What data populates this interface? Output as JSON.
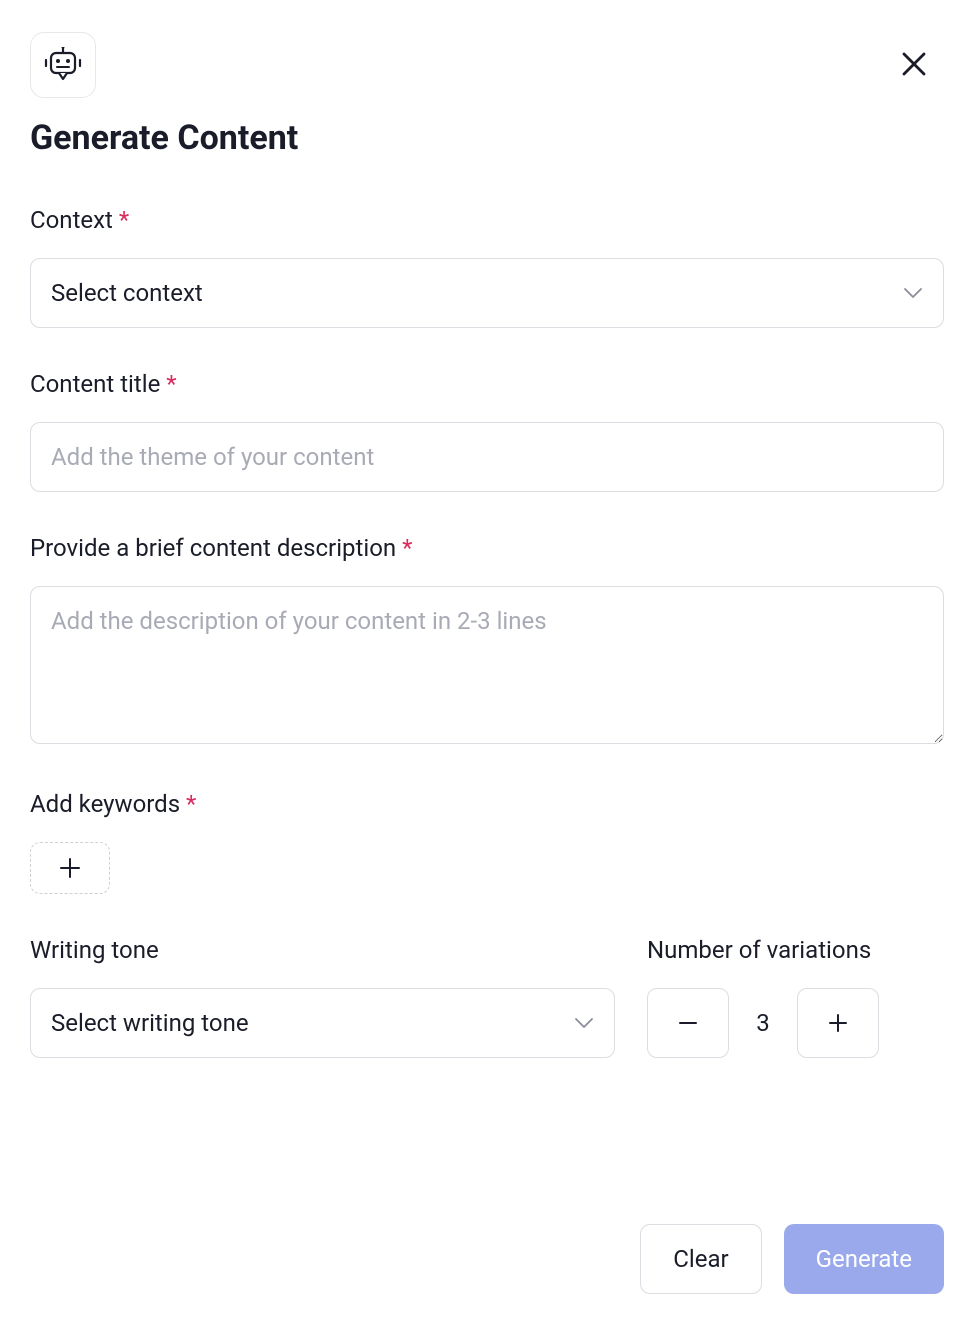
{
  "page_title": "Generate Content",
  "fields": {
    "context": {
      "label": "Context",
      "required": true,
      "placeholder": "Select context"
    },
    "content_title": {
      "label": "Content title",
      "required": true,
      "placeholder": "Add the theme of your content"
    },
    "description": {
      "label": "Provide a brief content description",
      "required": true,
      "placeholder": "Add the description of your content in 2-3 lines"
    },
    "keywords": {
      "label": "Add keywords",
      "required": true
    },
    "writing_tone": {
      "label": "Writing tone",
      "placeholder": "Select writing tone"
    },
    "variations": {
      "label": "Number of variations",
      "value": "3"
    }
  },
  "buttons": {
    "clear": "Clear",
    "generate": "Generate"
  },
  "required_marker": " *"
}
